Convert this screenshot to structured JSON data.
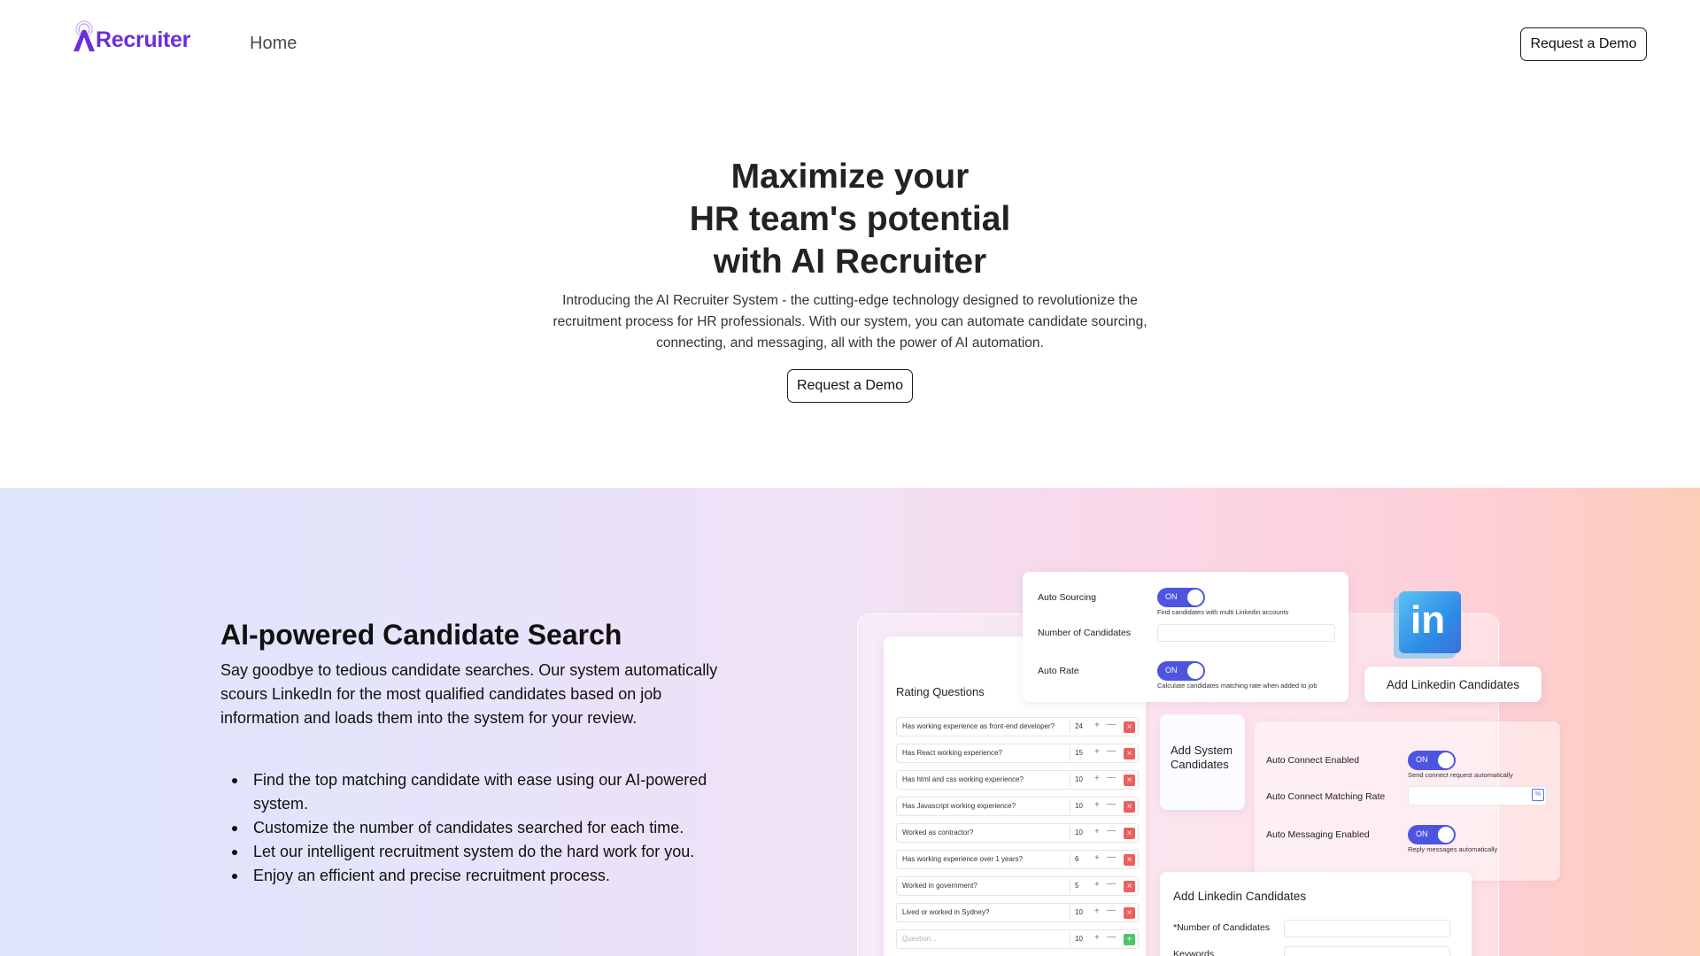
{
  "nav": {
    "logo_text": "Recruiter",
    "home_label": "Home",
    "demo_label": "Request a Demo"
  },
  "hero": {
    "title_lines": [
      "Maximize your",
      "HR team's potential",
      "with AI Recruiter"
    ],
    "description": "Introducing the AI Recruiter System - the cutting-edge technology designed to revolutionize the recruitment process for HR professionals. With our system, you can automate candidate sourcing, connecting, and messaging, all with the power of AI automation.",
    "demo_label": "Request a Demo"
  },
  "feature": {
    "title": "AI-powered Candidate Search",
    "description": "Say goodbye to tedious candidate searches. Our system automatically scours LinkedIn for the most qualified candidates based on job information and loads them into the system for your review.",
    "bullets": [
      "Find the top matching candidate with ease using our AI-powered system.",
      "Customize the number of candidates searched for each time.",
      "Let our intelligent recruitment system do the hard work for you.",
      "Enjoy an efficient and precise recruitment process."
    ]
  },
  "mockup": {
    "rating_title": "Rating Questions",
    "questions": [
      {
        "text": "Has working experience as front-end developer?",
        "value": "24"
      },
      {
        "text": "Has React working experience?",
        "value": "15"
      },
      {
        "text": "Has html and css working experience?",
        "value": "10"
      },
      {
        "text": "Has Javascript working experience?",
        "value": "10"
      },
      {
        "text": "Worked as contractor?",
        "value": "10"
      },
      {
        "text": "Has working experience over 1 years?",
        "value": "6"
      },
      {
        "text": "Worked in government?",
        "value": "5"
      },
      {
        "text": "Lived or worked in Sydney?",
        "value": "10"
      }
    ],
    "question_placeholder": "Question...",
    "question_new_value": "10",
    "auto_sourcing_label": "Auto Sourcing",
    "auto_sourcing_hint": "Find candidates with multi Linkedin accounts",
    "num_candidates_label": "Number of Candidates",
    "auto_rate_label": "Auto Rate",
    "auto_rate_hint": "Calculate candidates matching rate when added to job",
    "toggle_on": "ON",
    "linkedin_text": "in",
    "add_linkedin_label": "Add Linkedin Candidates",
    "add_system_label": "Add System Candidates",
    "auto_connect_label": "Auto Connect Enabled",
    "auto_connect_hint": "Send connect request automatically",
    "auto_connect_rate_label": "Auto Connect Matching Rate",
    "auto_messaging_label": "Auto Messaging Enabled",
    "auto_messaging_hint": "Reply messages automatically",
    "bottom_title": "Add Linkedin Candidates",
    "bottom_num_label": "*Number of Candidates",
    "bottom_keywords_label": "Keywords"
  },
  "colors": {
    "brand": "#6a2fd9",
    "toggle": "#4d55e0",
    "delete": "#f15d5d",
    "add": "#4cc46a"
  }
}
